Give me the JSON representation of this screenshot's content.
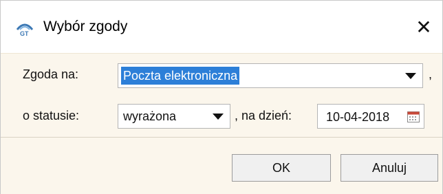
{
  "window": {
    "title": "Wybór zgody",
    "close_glyph": "✕",
    "icon": "gt-app-icon"
  },
  "form": {
    "consent_label": "Zgoda na:",
    "consent_value": "Poczta elektroniczna",
    "consent_suffix": ",",
    "status_label": "o statusie:",
    "status_value": "wyrażona",
    "date_label": ", na dzień:",
    "date_value": "10-04-2018"
  },
  "buttons": {
    "ok": "OK",
    "cancel": "Anuluj"
  },
  "colors": {
    "selection": "#2d7fd8",
    "panel": "#fbf6ec"
  }
}
